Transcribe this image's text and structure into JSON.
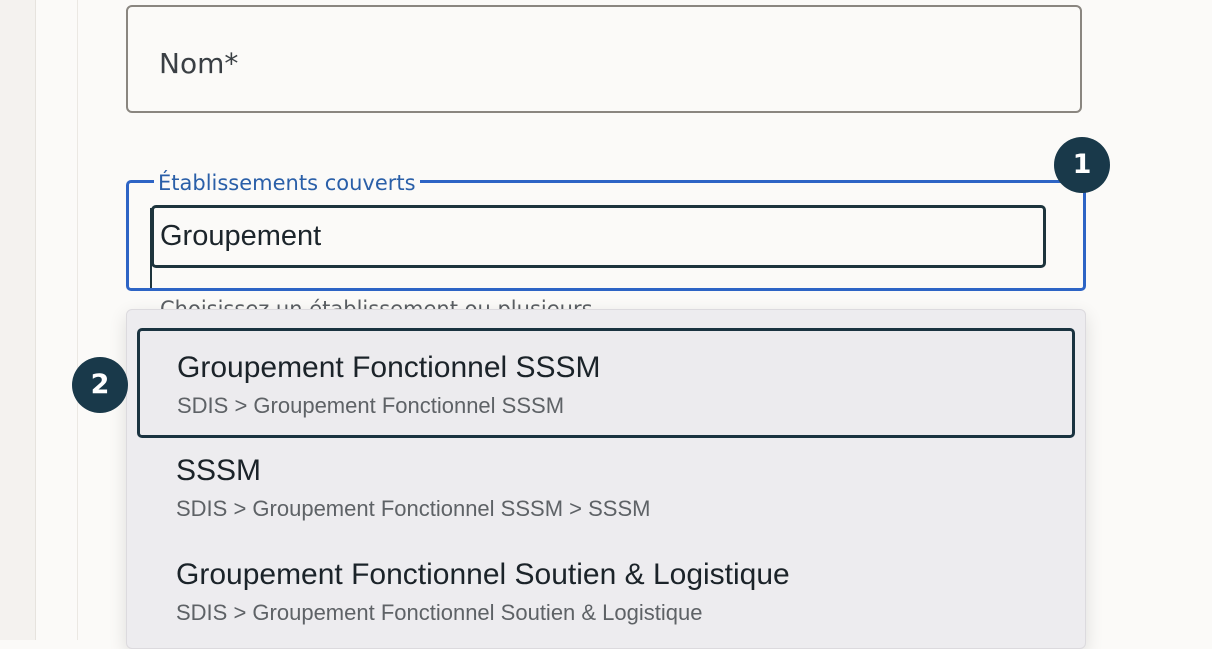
{
  "form": {
    "nom_label": "Nom*",
    "etablissements": {
      "legend": "Établissements couverts",
      "value": "Groupement",
      "helper": "Choisissez un établissement ou plusieurs"
    }
  },
  "annotations": {
    "badge_1": "1",
    "badge_2": "2"
  },
  "dropdown": {
    "options": [
      {
        "title": "Groupement Fonctionnel SSSM",
        "path": "SDIS > Groupement Fonctionnel SSSM",
        "selected": true
      },
      {
        "title": "SSSM",
        "path": "SDIS > Groupement Fonctionnel SSSM > SSSM",
        "selected": false
      },
      {
        "title": "Groupement Fonctionnel Soutien & Logistique",
        "path": "SDIS > Groupement Fonctionnel Soutien & Logistique",
        "selected": false
      }
    ]
  },
  "colors": {
    "focus_border": "#2d64c5",
    "badge_bg": "#19394a",
    "legend_text": "#2a5fa8"
  }
}
